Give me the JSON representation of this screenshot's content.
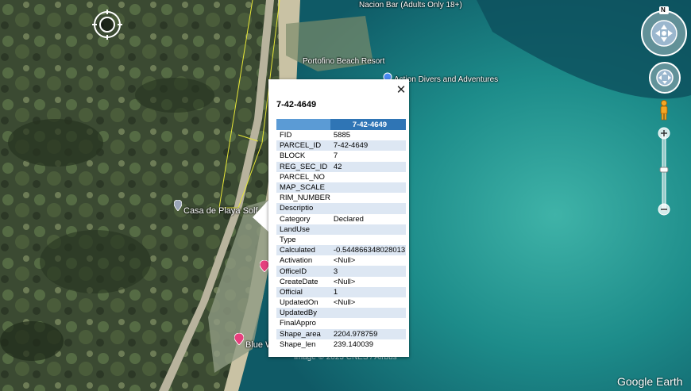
{
  "map": {
    "labels": [
      {
        "id": "bar",
        "text": "Nacion Bar (Adults Only 18+)"
      },
      {
        "id": "resort",
        "text": "Portofino Beach Resort"
      },
      {
        "id": "divers",
        "text": "Action Divers and Adventures"
      },
      {
        "id": "casa",
        "text": "Casa de Playa Solf"
      },
      {
        "id": "blue",
        "text": "Blue W"
      }
    ],
    "copyright": "Image © 2023 CNES / Airbus",
    "watermark": "Google Earth"
  },
  "popup": {
    "title": "7-42-4649",
    "header": [
      "",
      "7-42-4649"
    ],
    "rows": [
      [
        "FID",
        "5885"
      ],
      [
        "PARCEL_ID",
        "7-42-4649"
      ],
      [
        "BLOCK",
        "7"
      ],
      [
        "REG_SEC_ID",
        "42"
      ],
      [
        "PARCEL_NO",
        ""
      ],
      [
        "MAP_SCALE",
        ""
      ],
      [
        "RIM_NUMBER",
        ""
      ],
      [
        "Descriptio",
        ""
      ],
      [
        "Category",
        "Declared"
      ],
      [
        "LandUse",
        ""
      ],
      [
        "Type",
        ""
      ],
      [
        "Calculated",
        "-0.544866348028013"
      ],
      [
        "Activation",
        "<Null>"
      ],
      [
        "OfficeID",
        "3"
      ],
      [
        "CreateDate",
        "<Null>"
      ],
      [
        "Official",
        "1"
      ],
      [
        "UpdatedOn",
        "<Null>"
      ],
      [
        "UpdatedBy",
        ""
      ],
      [
        "FinalAppro",
        ""
      ],
      [
        "Shape_area",
        "2204.978759"
      ],
      [
        "Shape_len",
        "239.140039"
      ]
    ]
  },
  "nav": {
    "compass_letter": "N"
  },
  "colors": {
    "header": "#5b9bd5",
    "header_selected": "#2f75b5",
    "row_alt": "#dde7f3",
    "sea": "#1f8a8a"
  }
}
